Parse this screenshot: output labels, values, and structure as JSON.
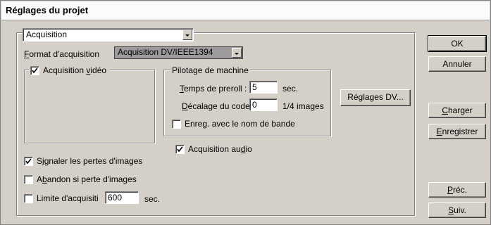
{
  "window": {
    "title": "Réglages du projet"
  },
  "section_select": {
    "value": "Acquisition"
  },
  "format": {
    "label_prefix": "F",
    "label_rest": "ormat d'acquisition",
    "value": "Acquisition DV/IEEE1394"
  },
  "video": {
    "label_prefix": "Acquisition ",
    "label_u": "v",
    "label_rest": "idéo",
    "checked": true
  },
  "machine": {
    "title": "Pilotage de machine",
    "preroll_label_u": "T",
    "preroll_label_rest": "emps de preroll :",
    "preroll_value": "5",
    "preroll_unit": "sec.",
    "offset_label_u": "D",
    "offset_label_rest": "écalage du code",
    "offset_value": "0",
    "offset_unit": "1/4 images",
    "tape_label_a": "Enre",
    "tape_label_u": "g",
    "tape_label_b": ". avec le nom de bande",
    "tape_checked": false
  },
  "dv_settings_button": "Réglages DV...",
  "audio": {
    "label_a": "Acquisition au",
    "label_u": "d",
    "label_b": "io",
    "checked": true
  },
  "report_drops": {
    "label_a": "S",
    "label_u": "i",
    "label_b": "gnaler les pertes d'images",
    "checked": true
  },
  "abort_drops": {
    "label_a": "A",
    "label_u": "b",
    "label_b": "andon si perte d'images",
    "checked": false
  },
  "limit": {
    "label": "Limite d'acquisiti",
    "value": "600",
    "unit": "sec.",
    "checked": false
  },
  "buttons": {
    "ok": "OK",
    "cancel": "Annuler",
    "load_u": "C",
    "load_rest": "harger",
    "save_u": "E",
    "save_rest": "nregistrer",
    "prev_u": "P",
    "prev_rest": "réc.",
    "next_u": "S",
    "next_rest": "uiv."
  }
}
